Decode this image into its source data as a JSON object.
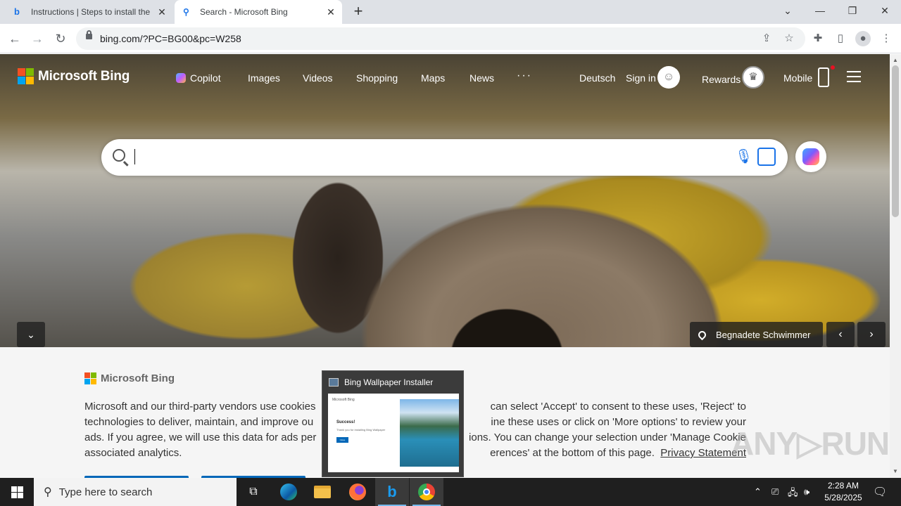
{
  "browser": {
    "tabs": [
      {
        "title": "Instructions | Steps to install the",
        "favicon": "bing-icon",
        "active": false
      },
      {
        "title": "Search - Microsoft Bing",
        "favicon": "search-icon",
        "active": true
      }
    ],
    "new_tab_label": "+",
    "url": "bing.com/?PC=BG00&pc=W258"
  },
  "bing": {
    "brand": "Microsoft Bing",
    "nav": {
      "copilot": "Copilot",
      "images": "Images",
      "videos": "Videos",
      "shopping": "Shopping",
      "maps": "Maps",
      "news": "News",
      "more": "···",
      "language": "Deutsch",
      "signin": "Sign in",
      "rewards": "Rewards",
      "mobile": "Mobile"
    },
    "search": {
      "value": "",
      "placeholder": ""
    },
    "image_location": "Begnadete Schwimmer"
  },
  "cookie_banner": {
    "brand": "Microsoft Bing",
    "text_part1": "Microsoft and our third-party vendors use cookies",
    "text_part1b": "can select 'Accept' to consent to these uses, 'Reject' to",
    "text_part2": "technologies to deliver, maintain, and improve ou",
    "text_part2b": "ine these uses or click on 'More options' to review your",
    "text_part3": "ads. If you agree, we will use this data for ads per",
    "text_part3b": "ions. You can change your selection under 'Manage Cookie",
    "text_part4": "associated analytics.",
    "text_part4b": "erences' at the bottom of this page.",
    "privacy_link": "Privacy Statement"
  },
  "taskbar_preview": {
    "title": "Bing Wallpaper Installer",
    "inner_brand": "Microsoft Bing",
    "inner_heading": "Success!",
    "inner_sub": "Thank you for installing Bing Wallpaper",
    "inner_button": "Close"
  },
  "taskbar": {
    "search_placeholder": "Type here to search",
    "time": "2:28 AM",
    "date": "5/28/2025"
  },
  "watermark": "ANY RUN",
  "colors": {
    "ms_red": "#f25022",
    "ms_green": "#7fba00",
    "ms_blue": "#00a4ef",
    "ms_yellow": "#ffb900",
    "accent_blue": "#0067b8"
  }
}
